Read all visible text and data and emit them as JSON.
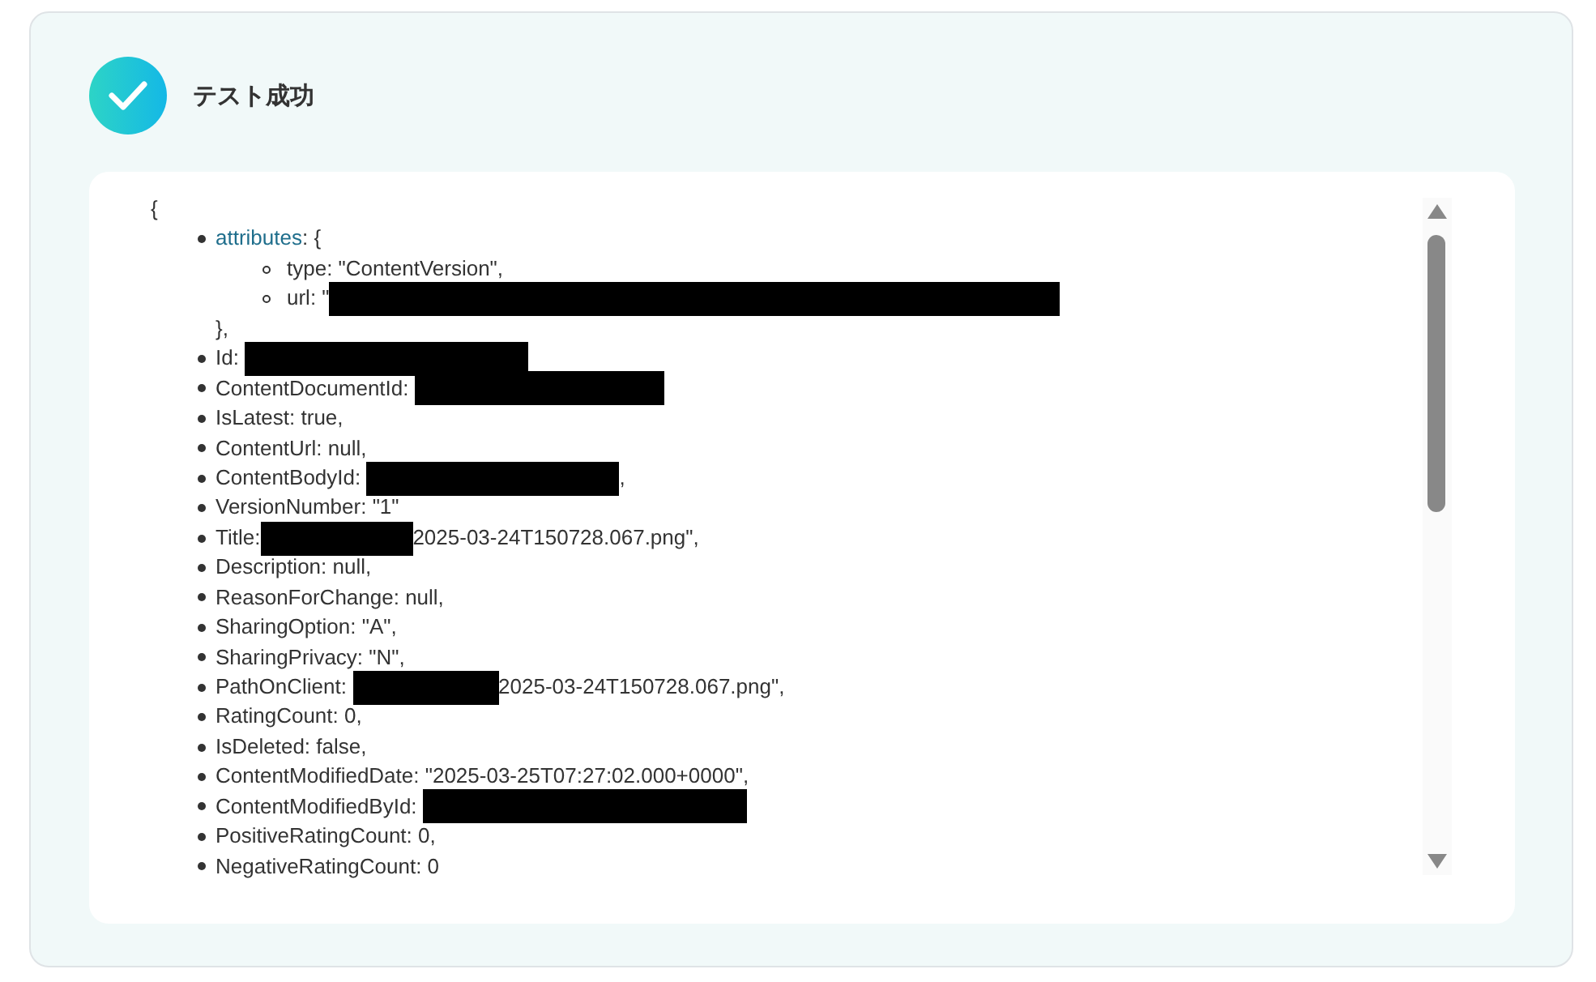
{
  "header": {
    "succeeded": true,
    "title": "テスト成功"
  },
  "response": {
    "open": "{",
    "items": [
      {
        "kind": "object",
        "key": "attributes",
        "suffix": ": {",
        "close": "},",
        "children": [
          {
            "segments": [
              {
                "kind": "text",
                "text": "type: \"ContentVersion\","
              }
            ]
          },
          {
            "segments": [
              {
                "kind": "text",
                "text": "url: \""
              },
              {
                "kind": "redaction"
              }
            ]
          }
        ]
      },
      {
        "kind": "field",
        "segments": [
          {
            "kind": "text",
            "text": "Id: "
          },
          {
            "kind": "redaction"
          }
        ]
      },
      {
        "kind": "field",
        "segments": [
          {
            "kind": "text",
            "text": "ContentDocumentId: "
          },
          {
            "kind": "redaction"
          }
        ]
      },
      {
        "kind": "field",
        "segments": [
          {
            "kind": "text",
            "text": "IsLatest: true,"
          }
        ]
      },
      {
        "kind": "field",
        "segments": [
          {
            "kind": "text",
            "text": "ContentUrl: null,"
          }
        ]
      },
      {
        "kind": "field",
        "segments": [
          {
            "kind": "text",
            "text": "ContentBodyId: "
          },
          {
            "kind": "redaction"
          },
          {
            "kind": "text",
            "text": ","
          }
        ]
      },
      {
        "kind": "field",
        "segments": [
          {
            "kind": "text",
            "text": "VersionNumber: \"1\""
          }
        ]
      },
      {
        "kind": "field",
        "segments": [
          {
            "kind": "text",
            "text": "Title:"
          },
          {
            "kind": "redaction"
          },
          {
            "kind": "text",
            "text": "2025-03-24T150728.067.png\","
          }
        ]
      },
      {
        "kind": "field",
        "segments": [
          {
            "kind": "text",
            "text": "Description: null,"
          }
        ]
      },
      {
        "kind": "field",
        "segments": [
          {
            "kind": "text",
            "text": "ReasonForChange: null,"
          }
        ]
      },
      {
        "kind": "field",
        "segments": [
          {
            "kind": "text",
            "text": "SharingOption: \"A\","
          }
        ]
      },
      {
        "kind": "field",
        "segments": [
          {
            "kind": "text",
            "text": "SharingPrivacy: \"N\","
          }
        ]
      },
      {
        "kind": "field",
        "segments": [
          {
            "kind": "text",
            "text": "PathOnClient: "
          },
          {
            "kind": "redaction"
          },
          {
            "kind": "text",
            "text": "2025-03-24T150728.067.png\","
          }
        ]
      },
      {
        "kind": "field",
        "segments": [
          {
            "kind": "text",
            "text": "RatingCount: 0,"
          }
        ]
      },
      {
        "kind": "field",
        "segments": [
          {
            "kind": "text",
            "text": "IsDeleted: false,"
          }
        ]
      },
      {
        "kind": "field",
        "segments": [
          {
            "kind": "text",
            "text": "ContentModifiedDate: \"2025-03-25T07:27:02.000+0000\","
          }
        ]
      },
      {
        "kind": "field",
        "segments": [
          {
            "kind": "text",
            "text": "ContentModifiedById: "
          },
          {
            "kind": "redaction"
          }
        ]
      },
      {
        "kind": "field",
        "segments": [
          {
            "kind": "text",
            "text": "PositiveRatingCount: 0,"
          }
        ]
      },
      {
        "kind": "field",
        "segments": [
          {
            "kind": "text",
            "text": "NegativeRatingCount: 0"
          }
        ]
      }
    ]
  }
}
